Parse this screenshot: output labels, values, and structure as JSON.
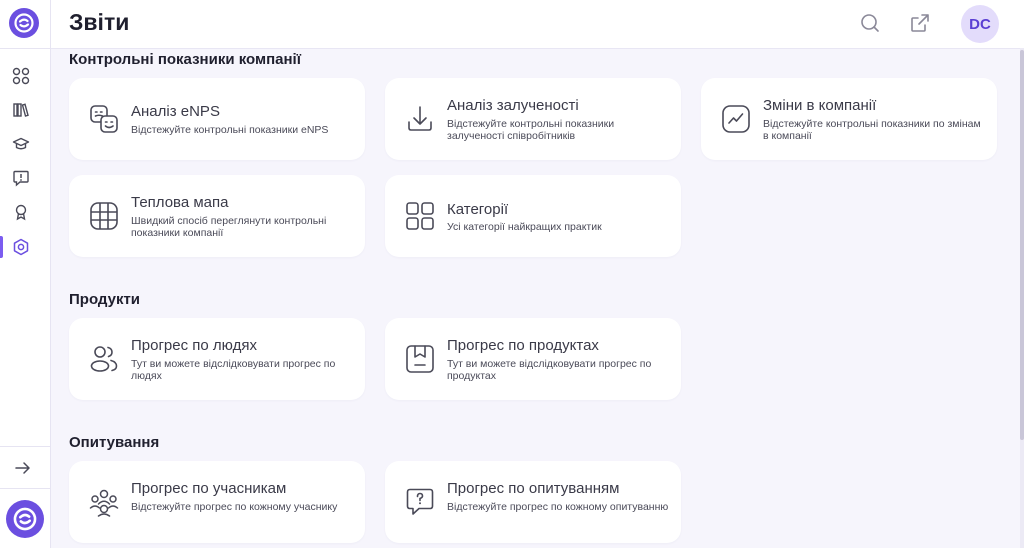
{
  "header": {
    "title": "Звіти",
    "avatar_initials": "DC"
  },
  "sections": [
    {
      "title": "Контрольні показники компанії"
    },
    {
      "title": "Продукти"
    },
    {
      "title": "Опитування"
    }
  ],
  "cards": [
    {
      "title": "Аналіз eNPS",
      "description": "Відстежуйте контрольні показники eNPS",
      "icon": "enps-faces-icon"
    },
    {
      "title": "Аналіз залученості",
      "description": "Відстежуйте контрольні показники залученості співробітників",
      "icon": "download-arrow-icon"
    },
    {
      "title": "Зміни в компанії",
      "description": "Відстежуйте контрольні показники по змінам в компанії",
      "icon": "trend-chart-icon"
    },
    {
      "title": "Теплова мапа",
      "description": "Швидкий спосіб переглянути контрольні показники компанії",
      "icon": "grid-icon"
    },
    {
      "title": "Категорії",
      "description": "Усі категорії найкращих практик",
      "icon": "four-squares-icon"
    },
    {
      "title": "Прогрес по людях",
      "description": "Тут ви можете відслідковувати прогрес по людях",
      "icon": "people-icon"
    },
    {
      "title": "Прогрес по продуктах",
      "description": "Тут ви можете відслідковувати прогрес по продуктах",
      "icon": "product-icon"
    },
    {
      "title": "Прогрес по учасникам",
      "description": "Відстежуйте прогрес по кожному учаснику",
      "icon": "group-icon"
    },
    {
      "title": "Прогрес по опитуванням",
      "description": "Відстежуйте прогрес по кожному опитуванню",
      "icon": "question-bubble-icon"
    }
  ],
  "colors": {
    "accent": "#6b4fe0",
    "background": "#f6f5fc",
    "card": "#ffffff",
    "avatar_bg": "#e3dcfb"
  }
}
